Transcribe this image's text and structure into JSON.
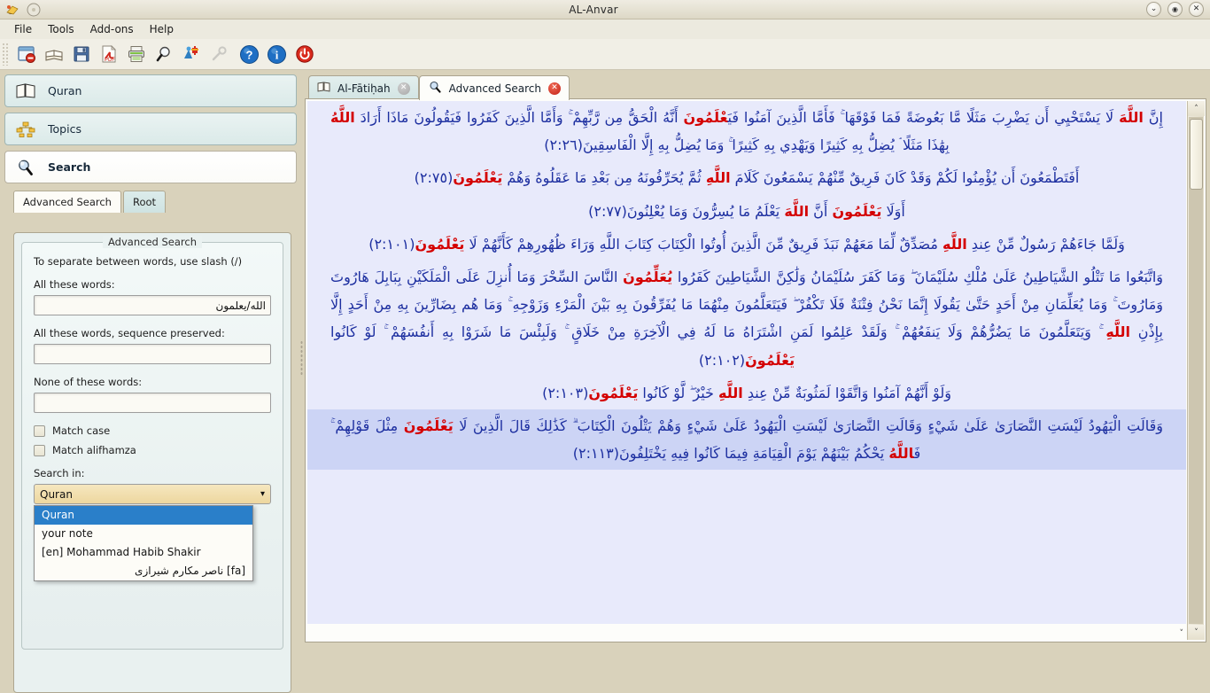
{
  "window": {
    "title": "AL-Anvar",
    "icons": {
      "app": "app-icon",
      "disc": "disc-icon"
    },
    "controls": [
      {
        "name": "minimize-button",
        "glyph": "⌄"
      },
      {
        "name": "maximize-button",
        "glyph": "⬚"
      },
      {
        "name": "close-button",
        "glyph": "✕"
      }
    ]
  },
  "menubar": {
    "items": [
      "File",
      "Tools",
      "Add-ons",
      "Help"
    ]
  },
  "toolbar": {
    "buttons": [
      {
        "name": "close-window-icon",
        "title": "Close"
      },
      {
        "name": "book-icon",
        "title": "Book"
      },
      {
        "name": "save-icon",
        "title": "Save"
      },
      {
        "name": "pdf-export-icon",
        "title": "Export PDF"
      },
      {
        "name": "print-icon",
        "title": "Print"
      },
      {
        "name": "search-icon",
        "title": "Search"
      },
      {
        "name": "addons-icon",
        "title": "Add-ons"
      },
      {
        "name": "settings-wrench-icon",
        "title": "Settings"
      },
      {
        "name": "help-icon",
        "title": "Help"
      },
      {
        "name": "info-icon",
        "title": "About"
      },
      {
        "name": "power-icon",
        "title": "Exit"
      }
    ]
  },
  "sidebar": {
    "nav": [
      {
        "label": "Quran",
        "icon": "open-book-icon",
        "active": false
      },
      {
        "label": "Topics",
        "icon": "tree-hierarchy-icon",
        "active": false
      },
      {
        "label": "Search",
        "icon": "magnifier-icon",
        "active": true
      }
    ],
    "tabs": [
      {
        "label": "Advanced Search",
        "selected": true
      },
      {
        "label": "Root",
        "selected": false
      }
    ],
    "group_title": "Advanced Search",
    "hint": "To separate between words, use slash (/)",
    "fields": [
      {
        "label": "All these words:",
        "value": "الله/يعلمون",
        "placeholder": ""
      },
      {
        "label": "All these words, sequence preserved:",
        "value": "",
        "placeholder": ""
      },
      {
        "label": "None of these words:",
        "value": "",
        "placeholder": ""
      }
    ],
    "checkboxes": [
      {
        "label": "Match case",
        "checked": false
      },
      {
        "label": "Match alifhamza",
        "checked": false
      }
    ],
    "search_in_label": "Search in:",
    "search_in_value": "Quran",
    "search_in_options": [
      {
        "label": "Quran",
        "selected": true,
        "rtl": false
      },
      {
        "label": "your note",
        "selected": false,
        "rtl": false
      },
      {
        "label": "[en]  Mohammad Habib Shakir",
        "selected": false,
        "rtl": false
      },
      {
        "label": "[fa]  ناصر مکارم شیرازی",
        "selected": false,
        "rtl": true
      }
    ]
  },
  "content_tabs": [
    {
      "label": "Al-Fātiḥah",
      "icon": "book-icon",
      "active": false,
      "close": "grey"
    },
    {
      "label": "Advanced Search",
      "icon": "magnifier-icon",
      "active": true,
      "close": "red"
    }
  ],
  "results": [
    {
      "id": "result-1",
      "highlighted": false,
      "ref": "(٢:٢٦)",
      "text": "إِنَّ <hw>اللَّهَ</hw> لَا يَسْتَحْيِي أَن يَضْرِبَ مَثَلًا مَّا بَعُوضَةً فَمَا فَوْقَهَا ۚ فَأَمَّا الَّذِينَ آمَنُوا فَيَ<hw>عْلَمُونَ</hw> أَنَّهُ الْحَقُّ مِن رَّبِّهِمْ ۚ وَأَمَّا الَّذِينَ كَفَرُوا فَيَقُولُونَ مَاذَا أَرَادَ <hw>اللَّهُ</hw> بِهَٰذَا مَثَلًا ۘ يُضِلُّ بِهِ كَثِيرًا وَيَهْدِي بِهِ كَثِيرًا ۚ وَمَا يُضِلُّ بِهِ إِلَّا الْفَاسِقِينَ"
    },
    {
      "id": "result-2",
      "highlighted": false,
      "ref": "(٢:٧٥)",
      "text": "أَفَتَطْمَعُونَ أَن يُؤْمِنُوا لَكُمْ وَقَدْ كَانَ فَرِيقٌ مِّنْهُمْ يَسْمَعُونَ كَلَامَ <hw>اللَّهِ</hw> ثُمَّ يُحَرِّفُونَهُ مِن بَعْدِ مَا عَقَلُوهُ وَهُمْ <hw>يَعْلَمُونَ</hw>"
    },
    {
      "id": "result-3",
      "highlighted": false,
      "ref": "(٢:٧٧)",
      "text": "أَوَلَا <hw>يَعْلَمُونَ</hw> أَنَّ <hw>اللَّهَ</hw> يَعْلَمُ مَا يُسِرُّونَ وَمَا يُعْلِنُونَ"
    },
    {
      "id": "result-4",
      "highlighted": false,
      "ref": "(٢:١٠١)",
      "text": "وَلَمَّا جَاءَهُمْ رَسُولٌ مِّنْ عِندِ <hw>اللَّهِ</hw> مُصَدِّقٌ لِّمَا مَعَهُمْ نَبَذَ فَرِيقٌ مِّنَ الَّذِينَ أُوتُوا الْكِتَابَ كِتَابَ اللَّهِ وَرَاءَ ظُهُورِهِمْ كَأَنَّهُمْ لَا <hw>يَعْلَمُونَ</hw>"
    },
    {
      "id": "result-5",
      "highlighted": false,
      "ref": "(٢:١٠٢)",
      "text": "وَاتَّبَعُوا مَا تَتْلُو الشَّيَاطِينُ عَلَىٰ مُلْكِ سُلَيْمَانَ ۖ وَمَا كَفَرَ سُلَيْمَانُ وَلَٰكِنَّ الشَّيَاطِينَ كَفَرُوا <hw>يُعَلِّمُونَ</hw> النَّاسَ السِّحْرَ وَمَا أُنزِلَ عَلَى الْمَلَكَيْنِ بِبَابِلَ هَارُوتَ وَمَارُوتَ ۚ وَمَا يُعَلِّمَانِ مِنْ أَحَدٍ حَتَّىٰ يَقُولَا إِنَّمَا نَحْنُ فِتْنَةٌ فَلَا تَكْفُرْ ۖ فَيَتَعَلَّمُونَ مِنْهُمَا مَا يُفَرِّقُونَ بِهِ بَيْنَ الْمَرْءِ وَزَوْجِهِ ۚ وَمَا هُم بِضَارِّينَ بِهِ مِنْ أَحَدٍ إِلَّا بِإِذْنِ <hw>اللَّهِ</hw> ۚ وَيَتَعَلَّمُونَ مَا يَضُرُّهُمْ وَلَا يَنفَعُهُمْ ۚ وَلَقَدْ عَلِمُوا لَمَنِ اشْتَرَاهُ مَا لَهُ فِي الْآخِرَةِ مِنْ خَلَاقٍ ۚ وَلَبِئْسَ مَا شَرَوْا بِهِ أَنفُسَهُمْ ۚ لَوْ كَانُوا <hw>يَعْلَمُونَ</hw>"
    },
    {
      "id": "result-6",
      "highlighted": false,
      "ref": "(٢:١٠٣)",
      "text": "وَلَوْ أَنَّهُمْ آمَنُوا وَاتَّقَوْا لَمَثُوبَةٌ مِّنْ عِندِ <hw>اللَّهِ</hw> خَيْرٌ ۖ لَّوْ كَانُوا <hw>يَعْلَمُونَ</hw>"
    },
    {
      "id": "result-7",
      "highlighted": true,
      "ref": "(٢:١١٣)",
      "text": "وَقَالَتِ الْيَهُودُ لَيْسَتِ النَّصَارَىٰ عَلَىٰ شَيْءٍ وَقَالَتِ النَّصَارَىٰ لَيْسَتِ الْيَهُودُ عَلَىٰ شَيْءٍ وَهُمْ يَتْلُونَ الْكِتَابَ ۗ كَذَٰلِكَ قَالَ الَّذِينَ لَا <hw>يَعْلَمُونَ</hw> مِثْلَ قَوْلِهِمْ ۚ فَ<hw>اللَّهُ</hw> يَحْكُمُ بَيْنَهُمْ يَوْمَ الْقِيَامَةِ فِيمَا كَانُوا فِيهِ يَخْتَلِفُونَ"
    }
  ],
  "scrollbar": {
    "up_glyph": "˄",
    "down_glyph": "˅"
  },
  "colors": {
    "highlight_word": "#d40000",
    "verse_text": "#1d2fa0",
    "page_bg": "#e8eafb",
    "row_highlight": "#ccd4f5",
    "dropdown_selection": "#2a7fc9"
  }
}
